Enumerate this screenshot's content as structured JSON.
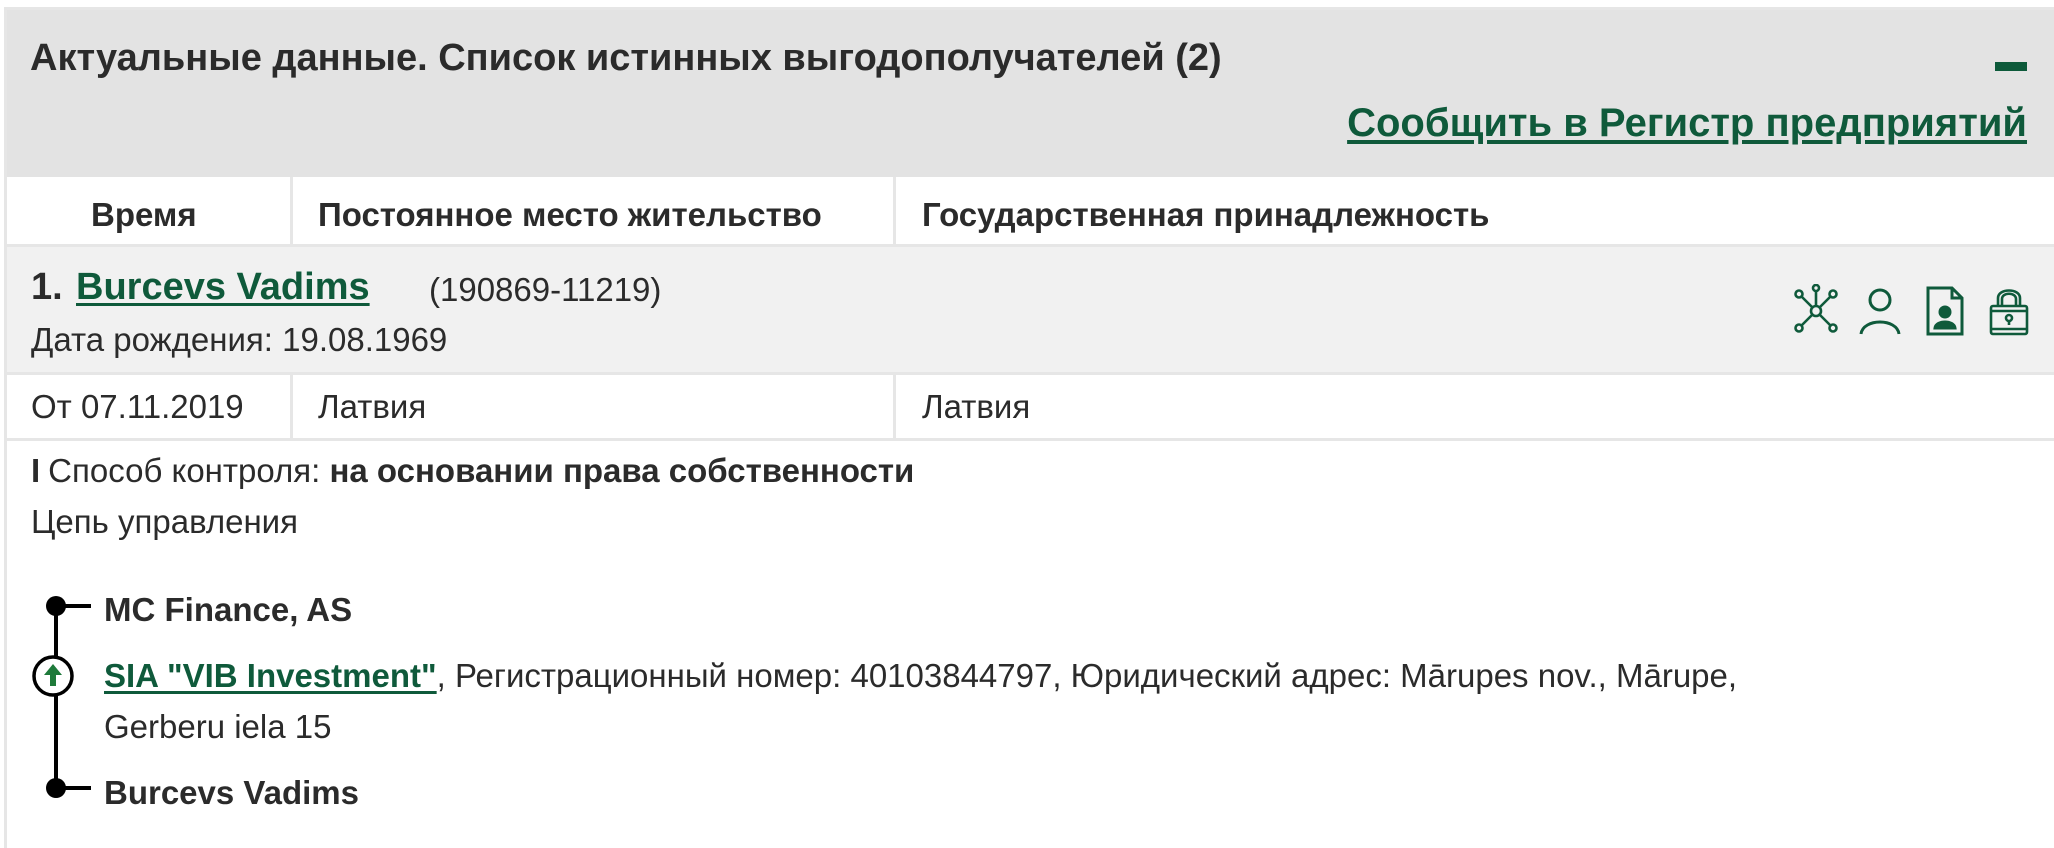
{
  "header": {
    "title": "Актуальные данные. Список истинных выгодополучателей (2)",
    "report_link": "Сообщить в Регистр предприятий"
  },
  "columns": {
    "time": "Время",
    "residence": "Постоянное место жительство",
    "citizenship": "Государственная принадлежность"
  },
  "person": {
    "number": "1.",
    "name": "Burcevs Vadims",
    "code": "(190869-11219)",
    "birth": "Дата рождения: 19.08.1969",
    "icons": [
      "network-icon",
      "person-icon",
      "id-card-icon",
      "lock-icon"
    ]
  },
  "row": {
    "time": "От 07.11.2019",
    "residence": "Латвия",
    "citizenship": "Латвия"
  },
  "control": {
    "bar": "I",
    "label": "Способ контроля:",
    "value": "на основании права собственности"
  },
  "chain": {
    "label": "Цепь управления",
    "top": "MC Finance, AS",
    "company_link": "SIA \"VIB Investment\"",
    "company_details_line1": ", Регистрационный номер: 40103844797, Юридический адрес: Mārupes nov., Mārupe,",
    "company_details_line2": "Gerberu iela 15",
    "bottom": "Burcevs Vadims"
  },
  "colors": {
    "accent": "#0f5a3b",
    "header_bg": "#e3e3e3",
    "row_bg": "#f1f1f1",
    "border": "#e6e6e6",
    "arrow_green": "#1e7a3a"
  }
}
